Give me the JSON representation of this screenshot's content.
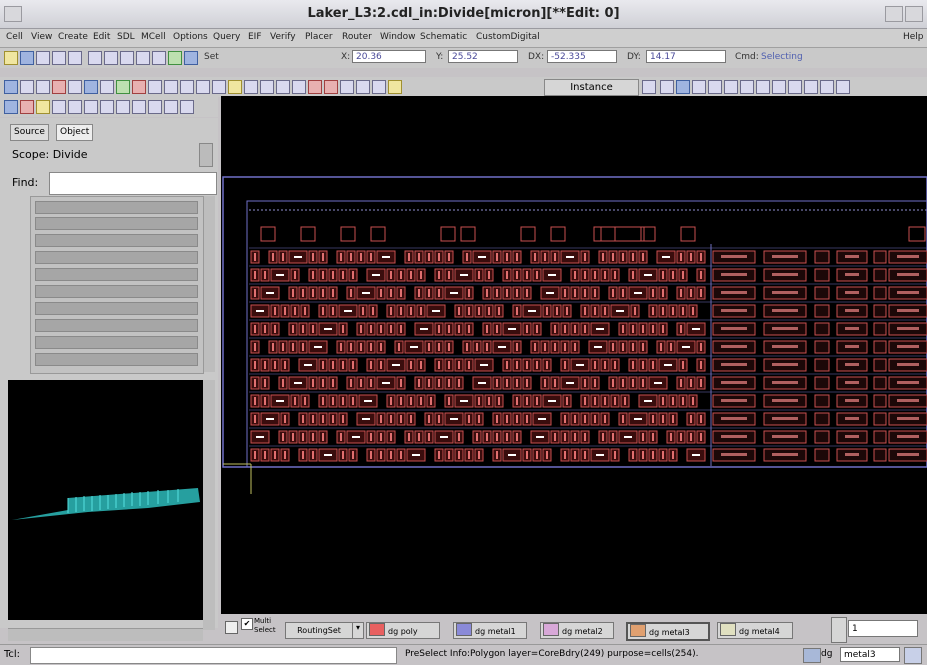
{
  "window": {
    "title": "Laker_L3:2.cdl_in:Divide[micron][**Edit: 0]"
  },
  "menu": {
    "items": [
      "Cell",
      "View",
      "Create",
      "Edit",
      "SDL",
      "MCell",
      "Options",
      "Query",
      "EIF",
      "Verify",
      "Placer",
      "Router",
      "Window",
      "Schematic",
      "CustomDigital"
    ],
    "help": "Help"
  },
  "toolbar1": {
    "set_label": "Set",
    "x_label": "X:",
    "x_value": "20.36",
    "y_label": "Y:",
    "y_value": "25.52",
    "dx_label": "DX:",
    "dx_value": "-52.335",
    "dy_label": "DY:",
    "dy_value": "14.17",
    "cmd_label": "Cmd:",
    "cmd_value": "Selecting"
  },
  "toolbar2": {
    "mode_label": "Instance"
  },
  "left_panel": {
    "tabs": [
      "Source",
      "Object"
    ],
    "scope_label": "Scope: Divide",
    "find_label": "Find:",
    "find_value": ""
  },
  "bottom": {
    "multi_label": "Multi Select",
    "routingset_label": "RoutingSet",
    "layers": [
      {
        "name": "poly",
        "color": "#e86060"
      },
      {
        "name": "metal1",
        "color": "#8a8ad8"
      },
      {
        "name": "metal2",
        "color": "#d8a8d8"
      },
      {
        "name": "metal3",
        "color": "#e0a070"
      },
      {
        "name": "metal4",
        "color": "#e0e0c0"
      }
    ],
    "dg_label": "dg",
    "spin_value": "1"
  },
  "status": {
    "tcl_label": "Tcl:",
    "message": "PreSelect Info:Polygon layer=CoreBdry(249) purpose=cells(254).",
    "dg_label": "dg",
    "layer_value": "metal3"
  },
  "colors": {
    "canvas_bg": "#000000",
    "cell_outline": "#c85050",
    "boundary": "#7070c8",
    "overview": "#30c0c0"
  }
}
